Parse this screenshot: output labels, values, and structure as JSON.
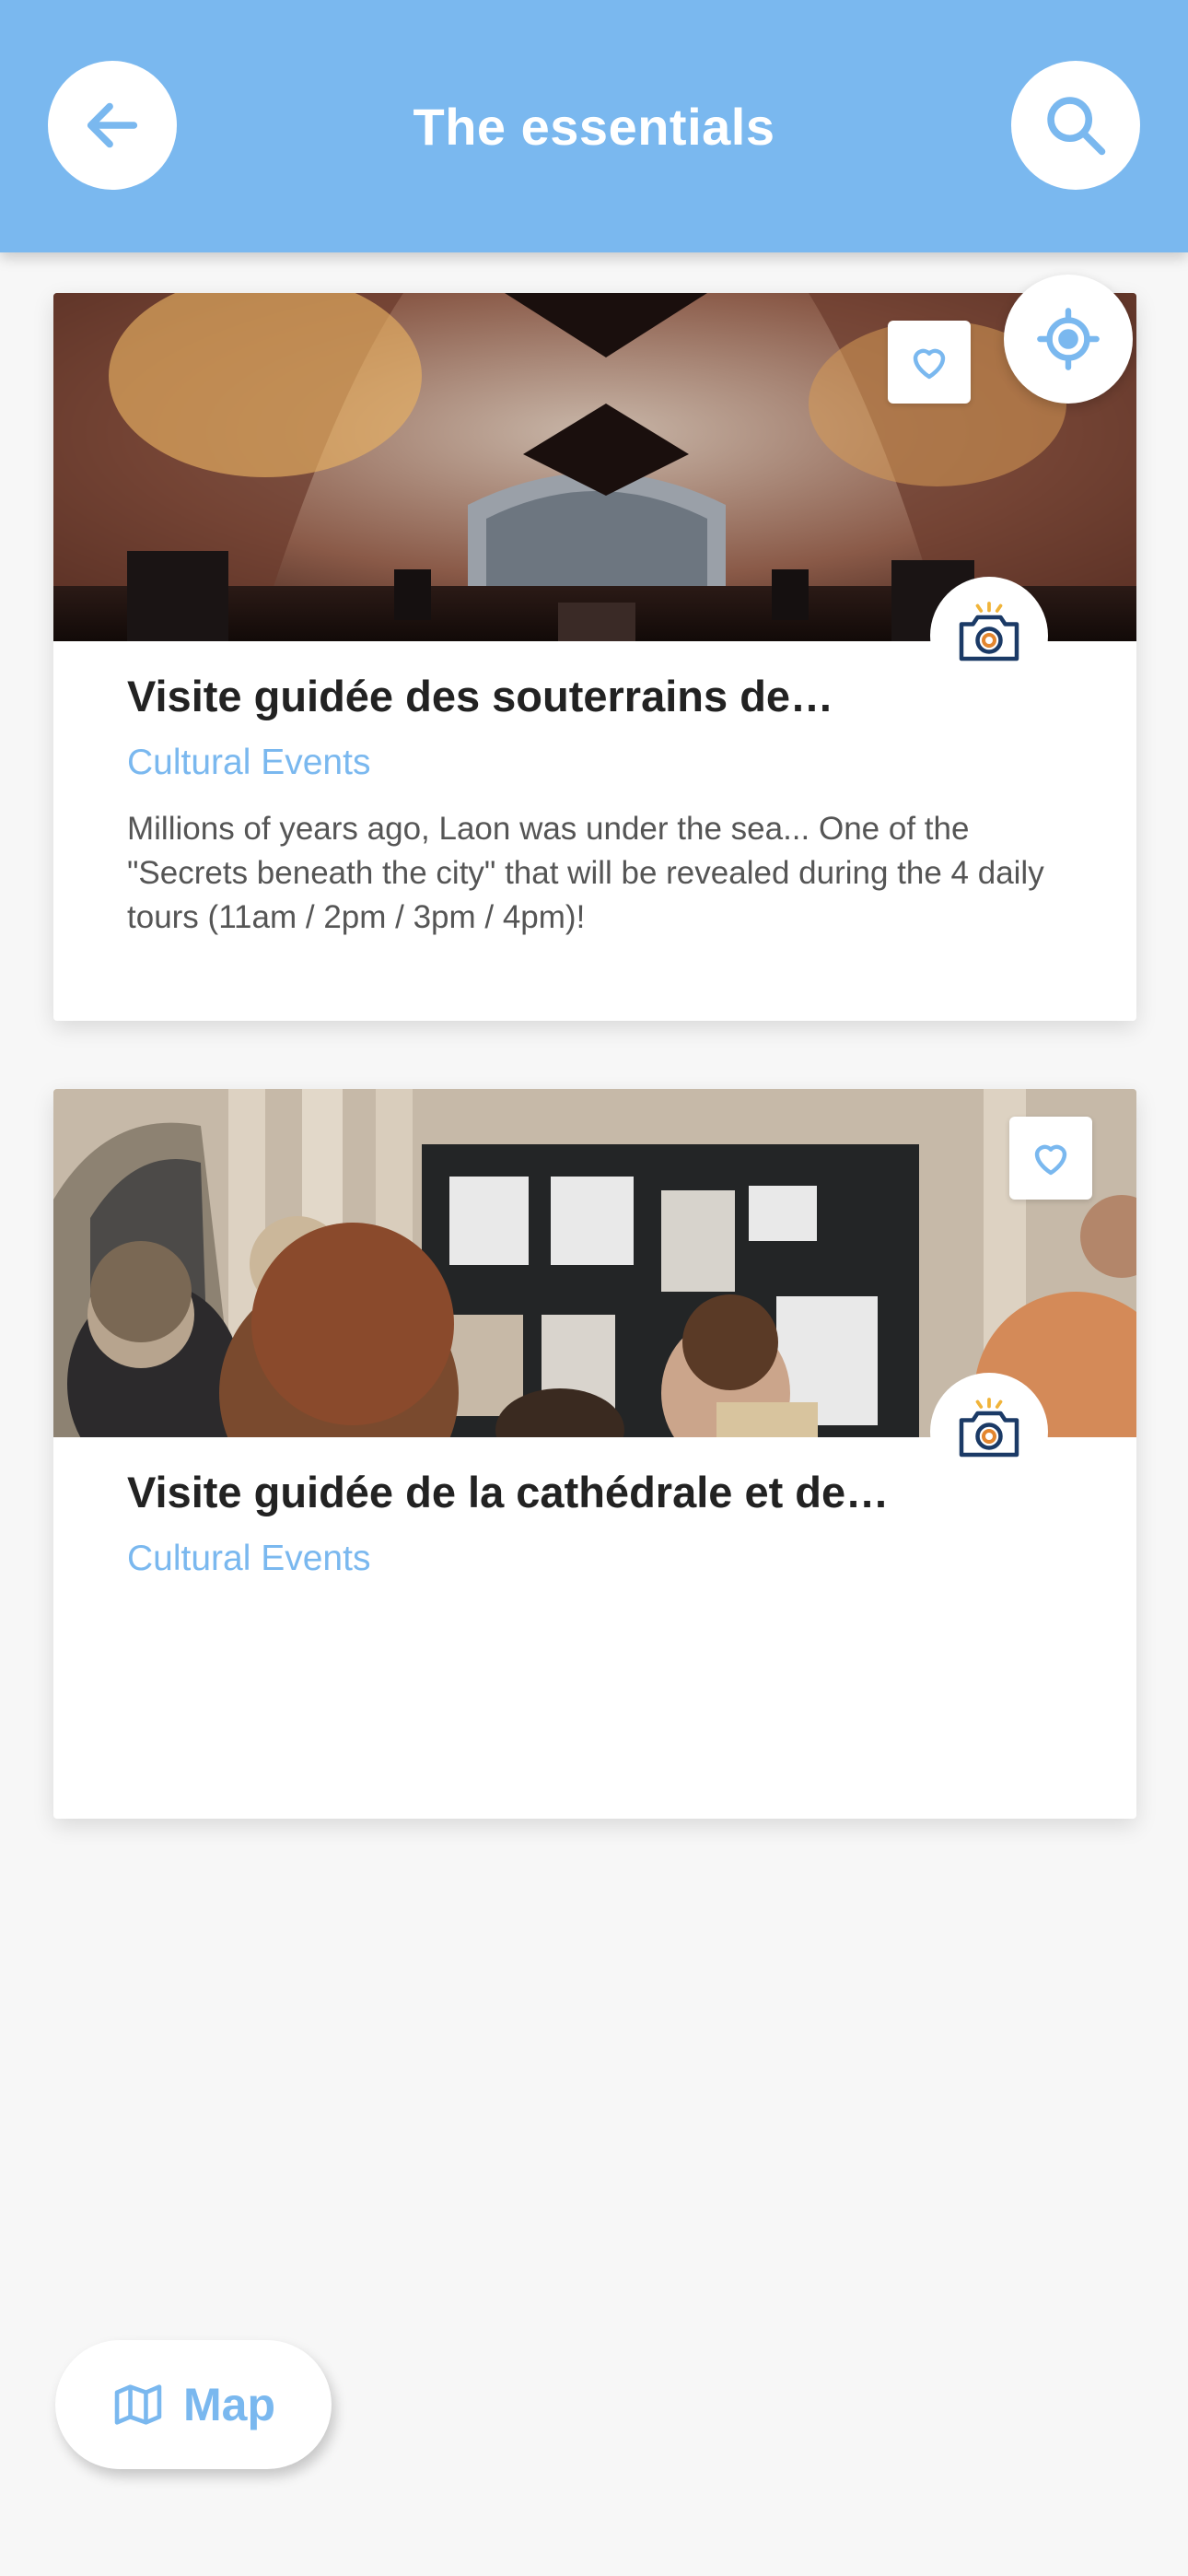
{
  "header": {
    "title": "The essentials",
    "back_icon": "arrow-left-icon",
    "search_icon": "search-icon",
    "color": "#7ab8ef"
  },
  "locate_icon": "crosshair-icon",
  "cards": [
    {
      "title": "Visite guidée des souterrains de…",
      "category": "Cultural Events",
      "description": "Millions of years ago, Laon was under the sea... One of the \"Secrets beneath the city\" that will be revealed during the 4 daily tours (11am / 2pm / 3pm / 4pm)!",
      "favorite_icon": "heart-icon",
      "badge_icon": "camera-icon"
    },
    {
      "title": "Visite guidée de la cathédrale et de…",
      "category": "Cultural Events",
      "description": "",
      "favorite_icon": "heart-icon",
      "badge_icon": "camera-icon"
    }
  ],
  "map_button": {
    "label": "Map",
    "icon": "map-icon"
  },
  "colors": {
    "accent": "#7ab8ef",
    "title_text": "#222222",
    "body_text": "#555555",
    "background": "#f7f7f7"
  }
}
